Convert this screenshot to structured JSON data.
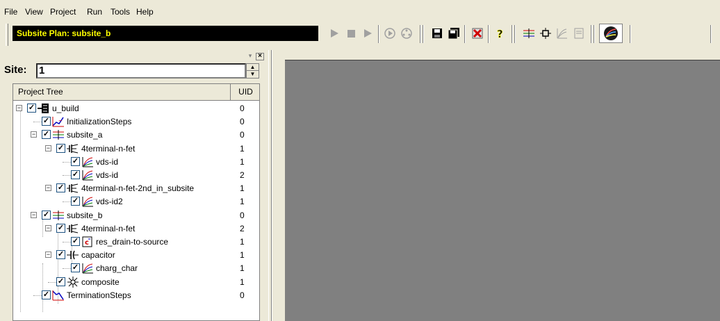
{
  "menu": [
    "File",
    "View",
    "Project",
    "Run",
    "Tools",
    "Help"
  ],
  "toolbar": {
    "plan_title": "Subsite Plan: subsite_b",
    "buttons": [
      "play-icon",
      "stop-icon",
      "step-icon",
      "run-single-icon",
      "run-multi-icon",
      "save-icon",
      "save-all-icon",
      "delete-icon",
      "help-icon",
      "subsite-icon",
      "device-icon",
      "test-icon",
      "page-icon",
      "plot-icon"
    ]
  },
  "panel": {
    "site_label": "Site:",
    "site_value": "1",
    "col_name": "Project Tree",
    "col_uid": "UID"
  },
  "tree": [
    {
      "label": "u_build",
      "uid": "0",
      "icon": "project-icon"
    },
    {
      "label": "InitializationSteps",
      "uid": "0",
      "icon": "init-steps-icon"
    },
    {
      "label": "subsite_a",
      "uid": "0",
      "icon": "subsite-icon"
    },
    {
      "label": "4terminal-n-fet",
      "uid": "1",
      "icon": "fet-device-icon"
    },
    {
      "label": "vds-id",
      "uid": "1",
      "icon": "test-curve-icon"
    },
    {
      "label": "vds-id",
      "uid": "2",
      "icon": "test-curve-icon"
    },
    {
      "label": "4terminal-n-fet-2nd_in_subsite",
      "uid": "1",
      "icon": "fet-device-icon"
    },
    {
      "label": "vds-id2",
      "uid": "1",
      "icon": "test-curve-icon"
    },
    {
      "label": "subsite_b",
      "uid": "0",
      "icon": "subsite-icon"
    },
    {
      "label": "4terminal-n-fet",
      "uid": "2",
      "icon": "fet-device-icon"
    },
    {
      "label": "res_drain-to-source",
      "uid": "1",
      "icon": "formula-test-icon"
    },
    {
      "label": "capacitor",
      "uid": "1",
      "icon": "capacitor-device-icon"
    },
    {
      "label": "charg_char",
      "uid": "1",
      "icon": "test-curve-icon"
    },
    {
      "label": "composite",
      "uid": "1",
      "icon": "composite-icon"
    },
    {
      "label": "TerminationSteps",
      "uid": "0",
      "icon": "term-steps-icon"
    }
  ]
}
